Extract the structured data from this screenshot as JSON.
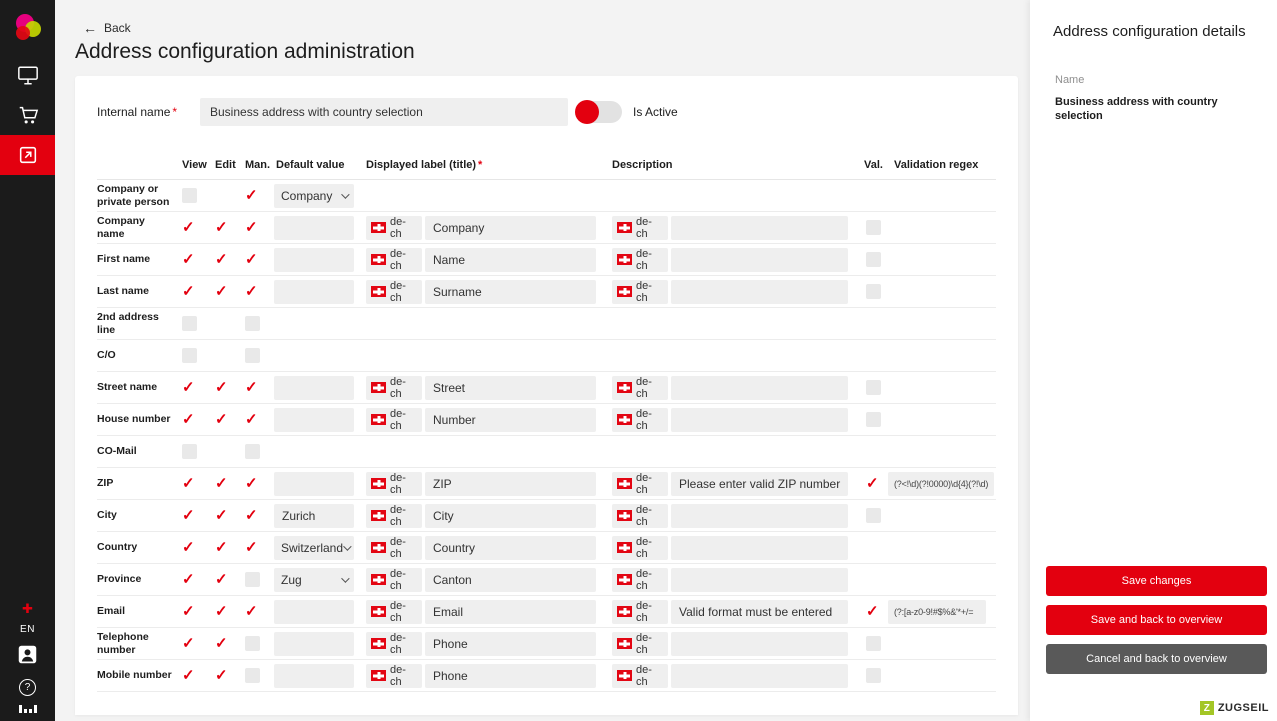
{
  "sidebar": {
    "language": "EN"
  },
  "header": {
    "back": "Back",
    "title": "Address configuration administration"
  },
  "form": {
    "internal_name": {
      "label": "Internal name",
      "value": "Business address with country selection"
    },
    "is_active": {
      "label": "Is Active",
      "on": true
    },
    "required_marker": "*"
  },
  "table": {
    "headers": {
      "view": "View",
      "edit": "Edit",
      "man": "Man.",
      "default": "Default value",
      "displayed": "Displayed label (title)",
      "description": "Description",
      "val": "Val.",
      "regex": "Validation regex"
    },
    "flag": "de-ch",
    "rows": [
      {
        "label": "Company or private person",
        "view": "empty",
        "edit": "none",
        "man": "checked",
        "default": {
          "type": "select",
          "value": "Company"
        },
        "displayed": null,
        "description": null,
        "val": "none",
        "regex": null
      },
      {
        "label": "Company name",
        "view": "checked",
        "edit": "checked",
        "man": "checked",
        "default": {
          "type": "input",
          "value": ""
        },
        "displayed": "Company",
        "description": "",
        "val": "empty",
        "regex": null
      },
      {
        "label": "First name",
        "view": "checked",
        "edit": "checked",
        "man": "checked",
        "default": {
          "type": "input",
          "value": ""
        },
        "displayed": "Name",
        "description": "",
        "val": "empty",
        "regex": null
      },
      {
        "label": "Last name",
        "view": "checked",
        "edit": "checked",
        "man": "checked",
        "default": {
          "type": "input",
          "value": ""
        },
        "displayed": "Surname",
        "description": "",
        "val": "empty",
        "regex": null
      },
      {
        "label": "2nd address line",
        "view": "empty",
        "edit": "none",
        "man": "empty",
        "default": null,
        "displayed": null,
        "description": null,
        "val": "none",
        "regex": null
      },
      {
        "label": "C/O",
        "view": "empty",
        "edit": "none",
        "man": "empty",
        "default": null,
        "displayed": null,
        "description": null,
        "val": "none",
        "regex": null
      },
      {
        "label": "Street name",
        "view": "checked",
        "edit": "checked",
        "man": "checked",
        "default": {
          "type": "input",
          "value": ""
        },
        "displayed": "Street",
        "description": "",
        "val": "empty",
        "regex": null
      },
      {
        "label": "House number",
        "view": "checked",
        "edit": "checked",
        "man": "checked",
        "default": {
          "type": "input",
          "value": ""
        },
        "displayed": "Number",
        "description": "",
        "val": "empty",
        "regex": null
      },
      {
        "label": "CO-Mail",
        "view": "empty",
        "edit": "none",
        "man": "empty",
        "default": null,
        "displayed": null,
        "description": null,
        "val": "none",
        "regex": null
      },
      {
        "label": "ZIP",
        "view": "checked",
        "edit": "checked",
        "man": "checked",
        "default": {
          "type": "input",
          "value": ""
        },
        "displayed": "ZIP",
        "description": "Please enter valid ZIP number",
        "val": "checked",
        "regex": "(?<!\\d)(?!0000)\\d{4}(?!\\d)"
      },
      {
        "label": "City",
        "view": "checked",
        "edit": "checked",
        "man": "checked",
        "default": {
          "type": "input",
          "value": "Zurich"
        },
        "displayed": "City",
        "description": "",
        "val": "empty",
        "regex": null
      },
      {
        "label": "Country",
        "view": "checked",
        "edit": "checked",
        "man": "checked",
        "default": {
          "type": "select",
          "value": "Switzerland"
        },
        "displayed": "Country",
        "description": "",
        "val": "none",
        "regex": null
      },
      {
        "label": "Province",
        "view": "checked",
        "edit": "checked",
        "man": "empty",
        "default": {
          "type": "select",
          "value": "Zug"
        },
        "displayed": "Canton",
        "description": "",
        "val": "none",
        "regex": null
      },
      {
        "label": "Email",
        "view": "checked",
        "edit": "checked",
        "man": "checked",
        "default": {
          "type": "input",
          "value": ""
        },
        "displayed": "Email",
        "description": "Valid format must be entered",
        "val": "checked",
        "regex": "(?:[a-z0-9!#$%&'*+/="
      },
      {
        "label": "Telephone number",
        "view": "checked",
        "edit": "checked",
        "man": "empty",
        "default": {
          "type": "input",
          "value": ""
        },
        "displayed": "Phone",
        "description": "",
        "val": "empty",
        "regex": null
      },
      {
        "label": "Mobile number",
        "view": "checked",
        "edit": "checked",
        "man": "empty",
        "default": {
          "type": "input",
          "value": ""
        },
        "displayed": "Phone",
        "description": "",
        "val": "empty",
        "regex": null
      }
    ]
  },
  "details": {
    "title": "Address configuration details",
    "name_label": "Name",
    "name_value": "Business address with country selection",
    "save": "Save changes",
    "save_back": "Save and back to overview",
    "cancel_back": "Cancel and back to overview"
  },
  "footer": {
    "brand": "ZUGSEIL"
  }
}
